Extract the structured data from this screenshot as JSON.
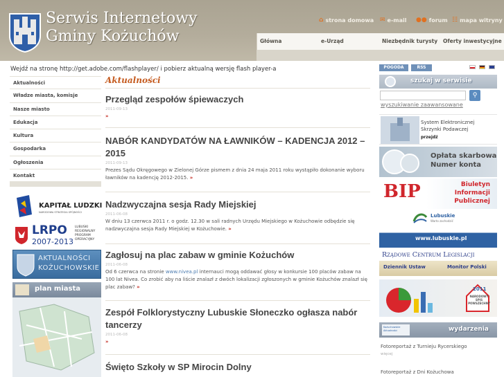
{
  "header": {
    "title_line1": "Serwis Internetowy",
    "title_line2": "Gminy Kożuchów",
    "top_links": [
      {
        "label": "strona domowa",
        "icon": "home-icon"
      },
      {
        "label": "e-mail",
        "icon": "mail-icon"
      },
      {
        "label": "forum",
        "icon": "forum-icon"
      },
      {
        "label": "mapa witryny",
        "icon": "sitemap-icon"
      }
    ],
    "menu": [
      "Główna",
      "e-Urząd",
      "Niezbędnik turysty",
      "Oferty inwestycyjne"
    ]
  },
  "flash_notice": "Wejdź na stronę http://get.adobe.com/flashplayer/ i pobierz aktualną wersję flash player-a",
  "left_nav": [
    "Aktualności",
    "Władze miasta, komisje",
    "Nasze miasto",
    "Edukacja",
    "Kultura",
    "Gospodarka",
    "Ogłoszenia",
    "Kontakt"
  ],
  "left_banners": {
    "kapital_title": "KAPITAŁ LUDZKI",
    "kapital_sub": "NARODOWA STRATEGIA SPÓJNOŚCI",
    "lrpo_title": "LRPO",
    "lrpo_years": "2007-2013",
    "lrpo_sub": "LUBUSKI REGIONALNY PROGRAM OPERACYJNY",
    "aktual_line1": "AKTUALNOŚCI",
    "aktual_line2": "KOŻUCHOWSKIE",
    "plan_label": "plan miasta"
  },
  "main": {
    "section_title": "Aktualności",
    "more_glyph": "»",
    "news": [
      {
        "title": "Przegląd zespołów śpiewaczych",
        "date": "2011-09-13",
        "body": ""
      },
      {
        "title": "NABÓR KANDYDATÓW NA ŁAWNIKÓW – KADENCJA 2012 – 2015",
        "date": "2011-09-13",
        "body": "Prezes Sądu Okręgowego w Zielonej Górze pismem z dnia 24 maja 2011 roku wystąpiło dokonanie wyboru ławników na kadencję 2012-2015."
      },
      {
        "title": "Nadzwyczajna sesja Rady Miejskiej",
        "date": "2011-06-08",
        "body": "W dniu 13 czerwca 2011 r. o godz. 12.30 w sali radnych Urzędu Miejskiego w Kożuchowie odbędzie się nadzwyczajna sesja Rady Miejskiej w Kożuchowie."
      },
      {
        "title": "Zagłosuj na plac zabaw w gminie Kożuchów",
        "date": "2011-06-08",
        "body_pre": "Od 6 czerwca na stronie ",
        "body_link": "www.nivea.pl",
        "body_post": " internauci mogą oddawać głosy w konkursie 100 placów zabaw na 100 lat Nivea. Co zrobić aby na liście znalazł z dwóch lokalizacji zgłoszonych w gminie Kożuchów znalazł się plac zabaw?"
      },
      {
        "title": "Zespół Folklorystyczny Lubuskie Słoneczko ogłasza nabór tancerzy",
        "date": "2011-06-08",
        "body": ""
      },
      {
        "title": "Święto Szkoły w SP Mirocin Dolny",
        "date": "",
        "body": ""
      }
    ]
  },
  "right": {
    "pogoda": "POGODA",
    "rss": "RSS",
    "search_label": "szukaj w serwisie",
    "search_value": "",
    "search_placeholder": "",
    "advanced": "wyszukiwanie zaawansowane",
    "esp_line1": "System Elektronicznej",
    "esp_line2": "Skrzynki Podawczej",
    "esp_go": "przejdź",
    "oplata_line1": "Opłata skarbowa",
    "oplata_line2": "Numer konta",
    "bip_logo": "BIP",
    "bip_line1": "Biuletyn",
    "bip_line2": "Informacji",
    "bip_line3": "Publicznej",
    "lubuskie_name": "Lubuskie",
    "lubuskie_tag": "Warto zachodzić",
    "lubuskie_url": "www.lubuskie.pl",
    "legis_title": "Rządowe Centrum Legislacji",
    "legis_left": "Dziennik Ustaw",
    "legis_right": "Monitor Polski",
    "spis_year": "2011",
    "spis_text": "NARODOWY SPIS POWSZECHNY",
    "wyd_banner": "Kożuchowskie Aktualności",
    "wyd_label": "wydarzenia",
    "events": [
      {
        "label": "Fotoreportaż z Turnieju Rycerskiego",
        "sub": "więcej"
      },
      {
        "label": "Fotoreportaż z Dni Kożuchowa",
        "sub": ""
      }
    ]
  },
  "colors": {
    "accent": "#c55a1e",
    "header_bg": "#aaa392",
    "link_blue": "#4c7cb0",
    "more_red": "#c3261c"
  }
}
